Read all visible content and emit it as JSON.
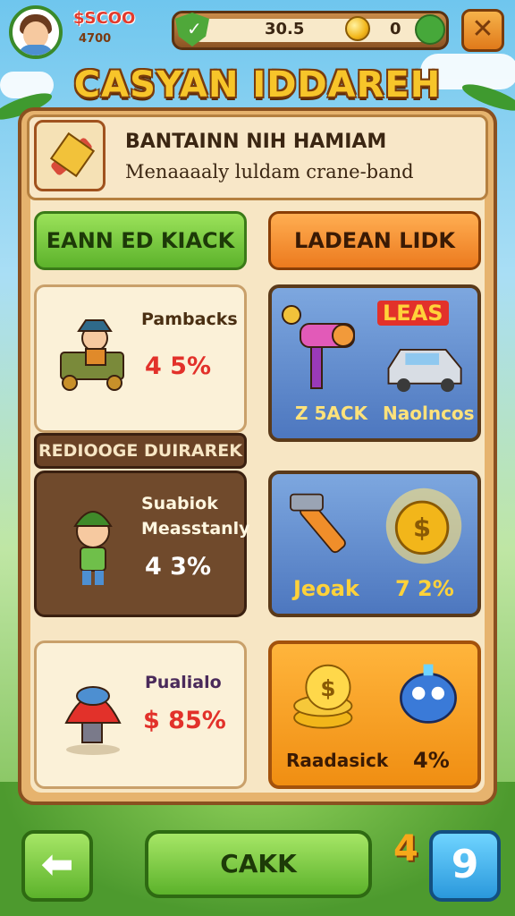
{
  "top_bar": {
    "money": "$SCOO",
    "money_sub": "4700",
    "resource_a": "30.5",
    "resource_b": "0",
    "close_label": "✕"
  },
  "title": "CASYAN IDDAREH",
  "header": {
    "title": "BANTAINN NIH HAMIAM",
    "subtitle": "Menaaaaly luldam crane-band"
  },
  "tabs": {
    "left": "EANN ED KIACK",
    "right": "LADEAN LIDK"
  },
  "cards": {
    "c1": {
      "name": "Pambacks",
      "pct": "4  5%"
    },
    "section_label": "REDIOOGE DUIRAREK",
    "c2": {
      "name1": "Suabiok",
      "name2": "Measstanly",
      "pct": "4  3%"
    },
    "c3": {
      "name": "Pualialo",
      "pct": "$  85%"
    },
    "c4": {
      "tag": "LEAS",
      "left": "Z 5ACK",
      "right": "Naolncos"
    },
    "c5": {
      "left": "Jeoak",
      "right": "7 2%"
    },
    "c6": {
      "left": "Raadasick",
      "right": "4%"
    }
  },
  "bottom": {
    "back": "⬅",
    "main": "CAKK",
    "count": "4",
    "help": "9"
  },
  "colors": {
    "green": "#5cb22b",
    "orange": "#ec7a1e",
    "blue": "#4d77bf",
    "panel": "#f7e6c4"
  }
}
